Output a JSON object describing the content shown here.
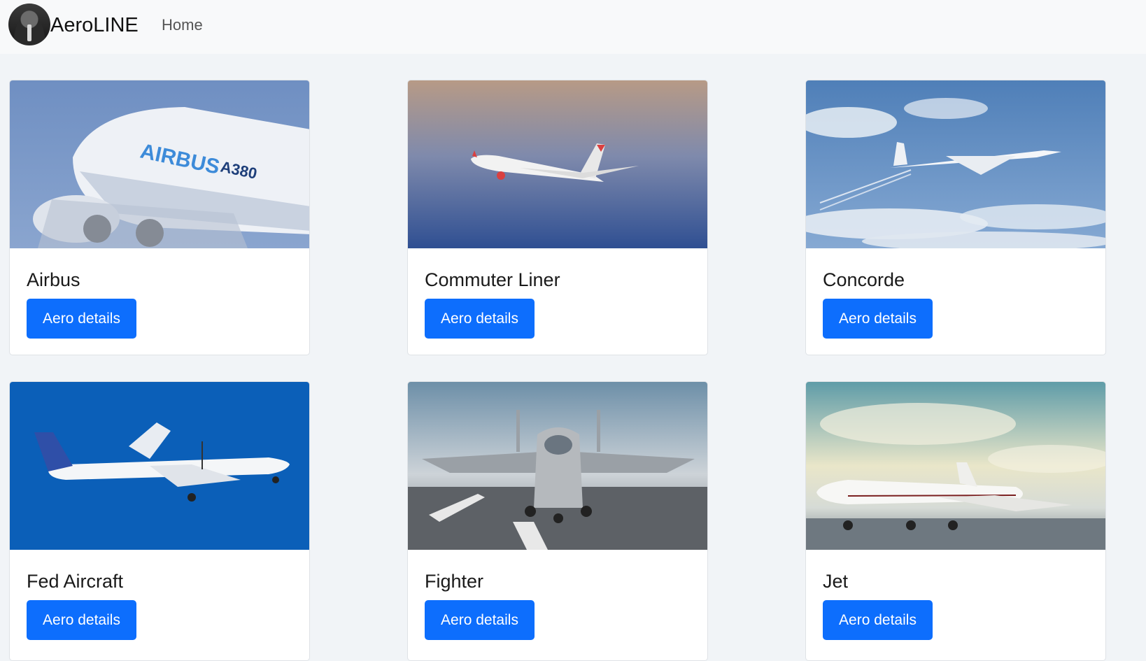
{
  "navbar": {
    "brand": "AeroLINE",
    "home_link": "Home"
  },
  "cards": [
    {
      "title": "Airbus",
      "button": "Aero details",
      "image_icon": "airbus-a380-photo"
    },
    {
      "title": "Commuter Liner",
      "button": "Aero details",
      "image_icon": "commuter-jet-photo"
    },
    {
      "title": "Concorde",
      "button": "Aero details",
      "image_icon": "concorde-photo"
    },
    {
      "title": "Fed Aircraft",
      "button": "Aero details",
      "image_icon": "turboprop-photo"
    },
    {
      "title": "Fighter",
      "button": "Aero details",
      "image_icon": "fighter-jet-photo"
    },
    {
      "title": "Jet",
      "button": "Aero details",
      "image_icon": "business-jet-photo"
    }
  ],
  "colors": {
    "primary": "#0d6efd",
    "navbar_bg": "#f8f9fa",
    "page_bg": "#f1f4f7"
  }
}
